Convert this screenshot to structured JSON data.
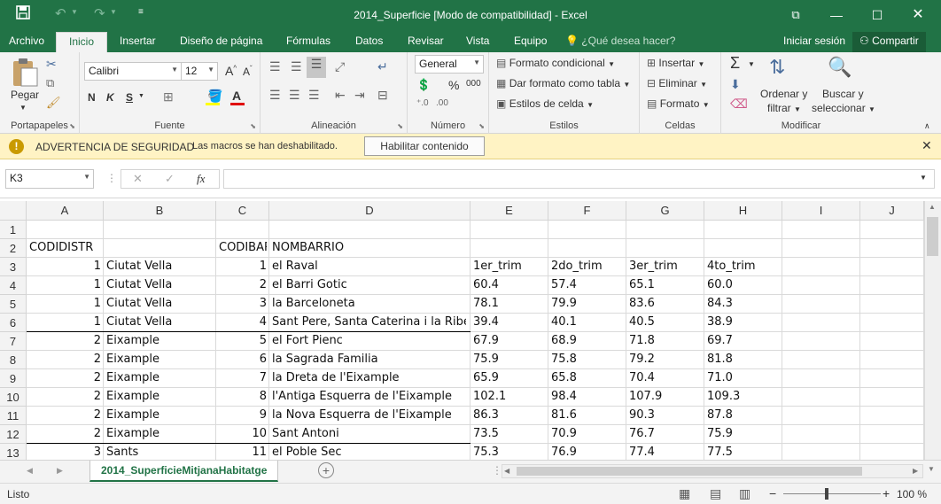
{
  "title": "2014_Superficie  [Modo de compatibilidad] - Excel",
  "quick_access": {
    "save": "save-icon",
    "undo": "undo-icon",
    "redo": "redo-icon",
    "customize": "customize-icon"
  },
  "window_controls": {
    "restore_ribbon": "ribbon-display-icon",
    "minimize": "minimize-icon",
    "maximize": "maximize-icon",
    "close": "close-icon"
  },
  "tabs": [
    "Archivo",
    "Inicio",
    "Insertar",
    "Diseño de página",
    "Fórmulas",
    "Datos",
    "Revisar",
    "Vista",
    "Equipo"
  ],
  "active_tab": "Inicio",
  "tell_me": "¿Qué desea hacer?",
  "signin": "Iniciar sesión",
  "share": "Compartir",
  "ribbon": {
    "portapapeles": {
      "label": "Portapapeles",
      "paste": "Pegar"
    },
    "fuente": {
      "label": "Fuente",
      "font_name": "Calibri",
      "font_size": "12",
      "bold": "N",
      "italic": "K",
      "underline": "S"
    },
    "alineacion": {
      "label": "Alineación"
    },
    "numero": {
      "label": "Número",
      "format": "General"
    },
    "estilos": {
      "label": "Estilos",
      "cond": "Formato condicional",
      "table": "Dar formato como tabla",
      "cell": "Estilos de celda"
    },
    "celdas": {
      "label": "Celdas",
      "insert": "Insertar",
      "delete": "Eliminar",
      "format": "Formato"
    },
    "modificar": {
      "label": "Modificar",
      "sort1": "Ordenar y",
      "sort2": "filtrar",
      "find1": "Buscar y",
      "find2": "seleccionar"
    }
  },
  "security": {
    "title": "ADVERTENCIA DE SEGURIDAD",
    "message": "Las macros se han deshabilitado.",
    "button": "Habilitar contenido"
  },
  "namebox": "K3",
  "formula_icon": "fx",
  "columns": [
    "A",
    "B",
    "C",
    "D",
    "E",
    "F",
    "G",
    "H",
    "I",
    "J"
  ],
  "rows": [
    {
      "n": "1",
      "cells": [
        "",
        "",
        "",
        "",
        "",
        "",
        "",
        ""
      ]
    },
    {
      "n": "2",
      "cells": [
        "CODIDISTR",
        "",
        "CODIBARRI",
        "NOMBARRIO",
        "",
        "",
        "",
        ""
      ]
    },
    {
      "n": "3",
      "cells": [
        "1",
        "Ciutat Vella",
        "1",
        "el Raval",
        "1er_trim",
        "2do_trim",
        "3er_trim",
        "4to_trim"
      ]
    },
    {
      "n": "4",
      "cells": [
        "1",
        "Ciutat Vella",
        "2",
        "el Barri Gotic",
        "60.4",
        "57.4",
        "65.1",
        "60.0"
      ]
    },
    {
      "n": "5",
      "cells": [
        "1",
        "Ciutat Vella",
        "3",
        "la Barceloneta",
        "78.1",
        "79.9",
        "83.6",
        "84.3"
      ]
    },
    {
      "n": "6",
      "cells": [
        "1",
        "Ciutat Vella",
        "4",
        "Sant Pere, Santa Caterina i la Ribera",
        "39.4",
        "40.1",
        "40.5",
        "38.9"
      ]
    },
    {
      "n": "7",
      "cells": [
        "2",
        "Eixample",
        "5",
        "el Fort Pienc",
        "67.9",
        "68.9",
        "71.8",
        "69.7"
      ]
    },
    {
      "n": "8",
      "cells": [
        "2",
        "Eixample",
        "6",
        "la Sagrada Familia",
        "75.9",
        "75.8",
        "79.2",
        "81.8"
      ]
    },
    {
      "n": "9",
      "cells": [
        "2",
        "Eixample",
        "7",
        "la Dreta de l'Eixample",
        "65.9",
        "65.8",
        "70.4",
        "71.0"
      ]
    },
    {
      "n": "10",
      "cells": [
        "2",
        "Eixample",
        "8",
        "l'Antiga Esquerra de l'Eixample",
        "102.1",
        "98.4",
        "107.9",
        "109.3"
      ]
    },
    {
      "n": "11",
      "cells": [
        "2",
        "Eixample",
        "9",
        "la Nova Esquerra de l'Eixample",
        "86.3",
        "81.6",
        "90.3",
        "87.8"
      ]
    },
    {
      "n": "12",
      "cells": [
        "2",
        "Eixample",
        "10",
        "Sant Antoni",
        "73.5",
        "70.9",
        "76.7",
        "75.9"
      ]
    },
    {
      "n": "13",
      "cells": [
        "3",
        "Sants",
        "11",
        "el Poble Sec",
        "75.3",
        "76.9",
        "77.4",
        "77.5"
      ]
    }
  ],
  "sheet_tab": "2014_SuperficieMitjanaHabitatge",
  "status": "Listo",
  "zoom": "100 %",
  "colors": {
    "excel_green": "#217346",
    "security_bg": "#fff3c4"
  }
}
